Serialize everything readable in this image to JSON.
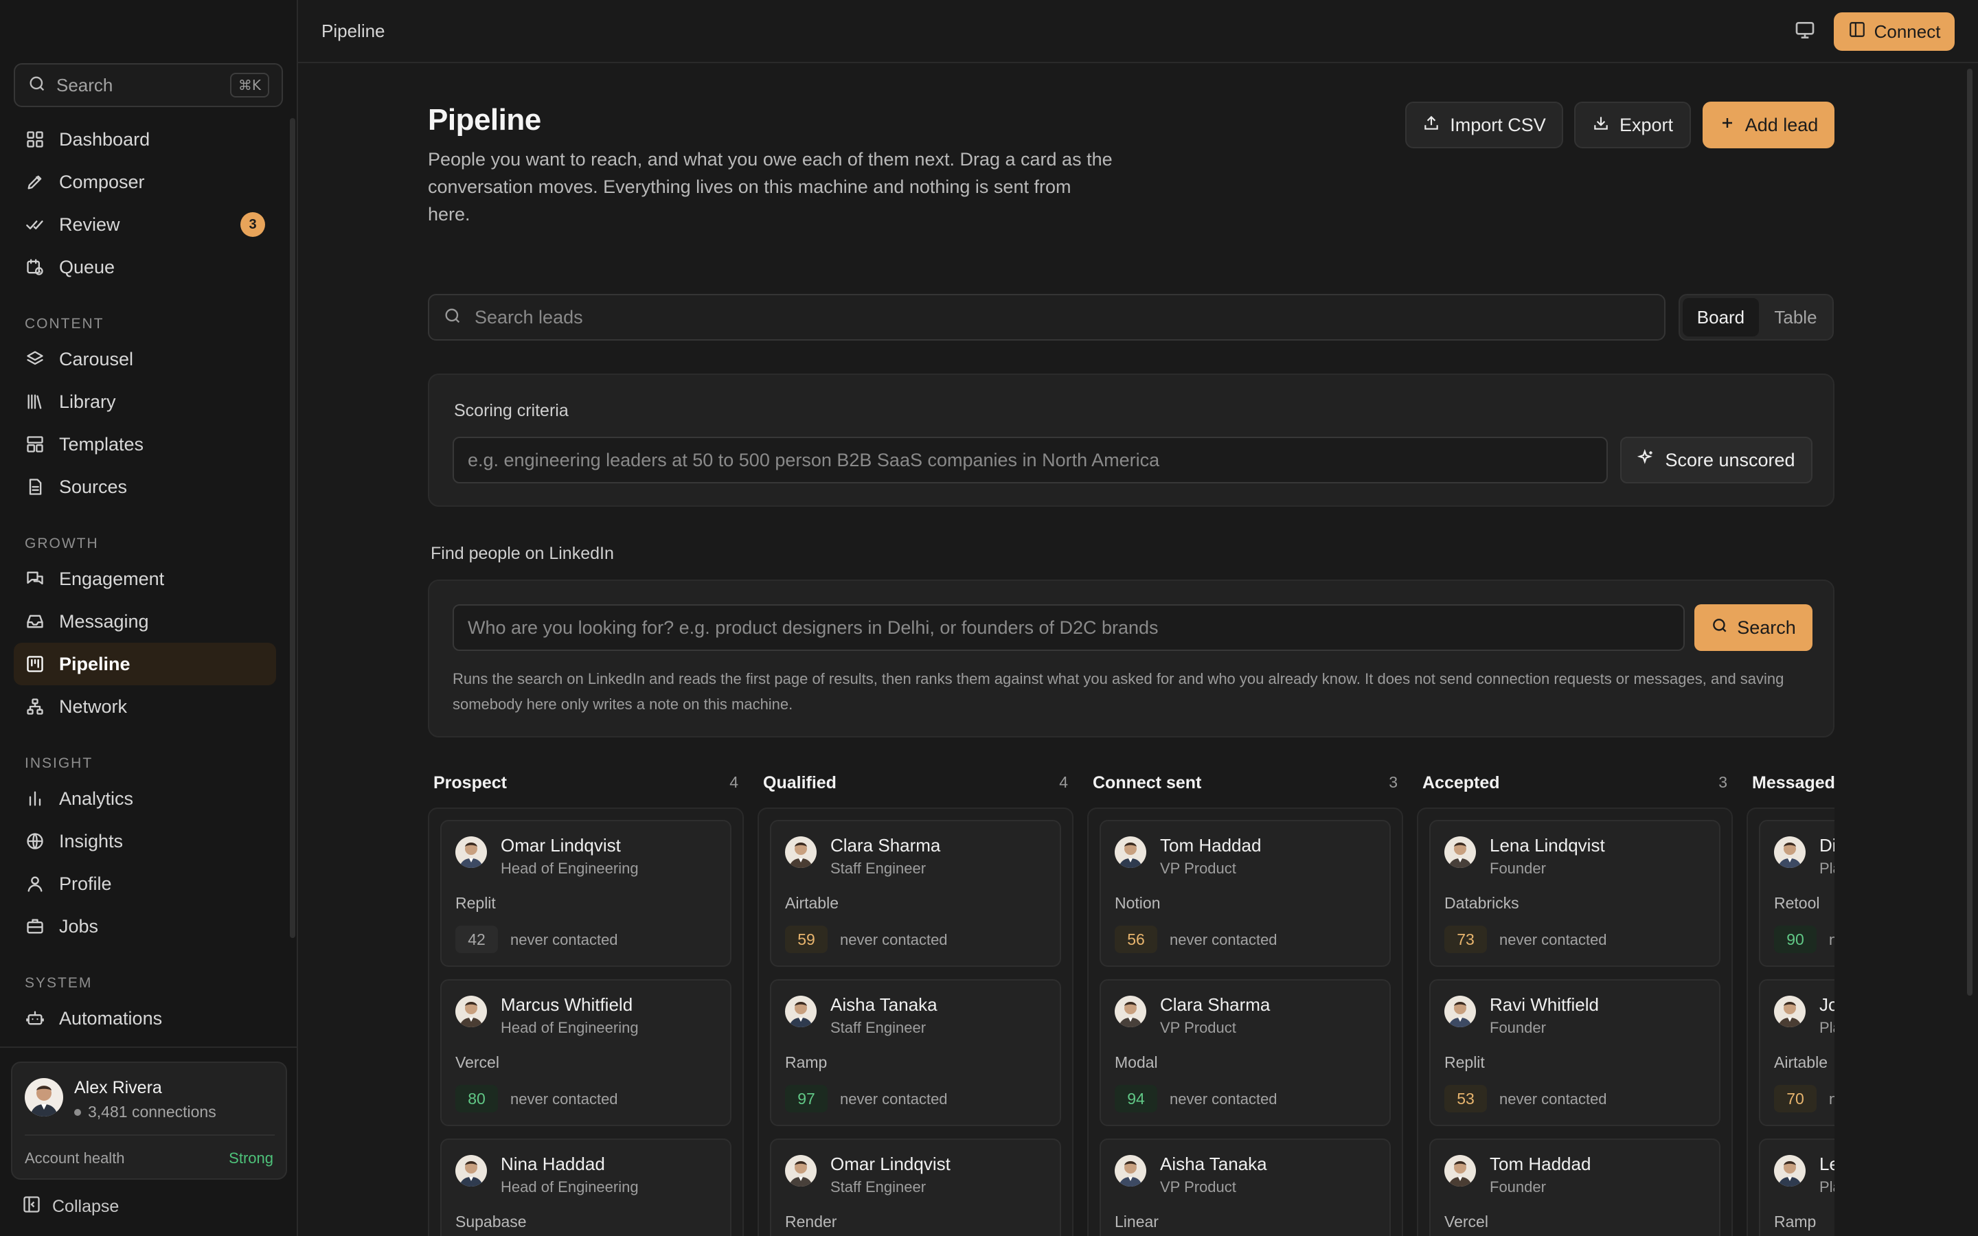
{
  "sidebar": {
    "search": {
      "label": "Search",
      "shortcut": "⌘K"
    },
    "nav_top": [
      {
        "label": "Dashboard",
        "icon": "grid-icon"
      },
      {
        "label": "Composer",
        "icon": "pen-icon"
      },
      {
        "label": "Review",
        "icon": "double-check-icon",
        "badge": "3"
      },
      {
        "label": "Queue",
        "icon": "calendar-clock-icon"
      }
    ],
    "sections": [
      {
        "title": "CONTENT",
        "items": [
          {
            "label": "Carousel",
            "icon": "layers-icon"
          },
          {
            "label": "Library",
            "icon": "library-icon"
          },
          {
            "label": "Templates",
            "icon": "layout-icon"
          },
          {
            "label": "Sources",
            "icon": "file-icon"
          }
        ]
      },
      {
        "title": "GROWTH",
        "items": [
          {
            "label": "Engagement",
            "icon": "messages-icon"
          },
          {
            "label": "Messaging",
            "icon": "inbox-icon"
          },
          {
            "label": "Pipeline",
            "icon": "kanban-icon",
            "active": true
          },
          {
            "label": "Network",
            "icon": "network-icon"
          }
        ]
      },
      {
        "title": "INSIGHT",
        "items": [
          {
            "label": "Analytics",
            "icon": "bar-chart-icon"
          },
          {
            "label": "Insights",
            "icon": "globe-icon"
          },
          {
            "label": "Profile",
            "icon": "user-icon"
          },
          {
            "label": "Jobs",
            "icon": "briefcase-icon"
          }
        ]
      },
      {
        "title": "SYSTEM",
        "items": [
          {
            "label": "Automations",
            "icon": "bot-icon"
          }
        ]
      }
    ],
    "profile": {
      "name": "Alex Rivera",
      "connections": "3,481 connections",
      "health_label": "Account health",
      "health_value": "Strong"
    },
    "collapse_label": "Collapse"
  },
  "topbar": {
    "breadcrumb": "Pipeline",
    "connect_label": "Connect"
  },
  "header": {
    "title": "Pipeline",
    "subtitle": "People you want to reach, and what you owe each of them next. Drag a card as the conversation moves. Everything lives on this machine and nothing is sent from here.",
    "import_label": "Import CSV",
    "export_label": "Export",
    "add_label": "Add lead"
  },
  "lead_search": {
    "placeholder": "Search leads"
  },
  "view_toggle": {
    "board": "Board",
    "table": "Table",
    "selected": "Board"
  },
  "scoring": {
    "title": "Scoring criteria",
    "placeholder": "e.g. engineering leaders at 50 to 500 person B2B SaaS companies in North America",
    "button": "Score unscored"
  },
  "linkedin": {
    "title": "Find people on LinkedIn",
    "placeholder": "Who are you looking for? e.g. product designers in Delhi, or founders of D2C brands",
    "button": "Search",
    "note": "Runs the search on LinkedIn and reads the first page of results, then ranks them against what you asked for and who you already know. It does not send connection requests or messages, and saving somebody here only writes a note on this machine."
  },
  "board": {
    "columns": [
      {
        "name": "Prospect",
        "count": "4",
        "cards": [
          {
            "name": "Omar Lindqvist",
            "role": "Head of Engineering",
            "company": "Replit",
            "score": "42",
            "tier": "low",
            "status": "never contacted"
          },
          {
            "name": "Marcus Whitfield",
            "role": "Head of Engineering",
            "company": "Vercel",
            "score": "80",
            "tier": "high",
            "status": "never contacted"
          },
          {
            "name": "Nina Haddad",
            "role": "Head of Engineering",
            "company": "Supabase",
            "score": "",
            "tier": "low",
            "status": ""
          }
        ]
      },
      {
        "name": "Qualified",
        "count": "4",
        "cards": [
          {
            "name": "Clara Sharma",
            "role": "Staff Engineer",
            "company": "Airtable",
            "score": "59",
            "tier": "mid",
            "status": "never contacted"
          },
          {
            "name": "Aisha Tanaka",
            "role": "Staff Engineer",
            "company": "Ramp",
            "score": "97",
            "tier": "high",
            "status": "never contacted"
          },
          {
            "name": "Omar Lindqvist",
            "role": "Staff Engineer",
            "company": "Render",
            "score": "",
            "tier": "low",
            "status": ""
          }
        ]
      },
      {
        "name": "Connect sent",
        "count": "3",
        "cards": [
          {
            "name": "Tom Haddad",
            "role": "VP Product",
            "company": "Notion",
            "score": "56",
            "tier": "mid",
            "status": "never contacted"
          },
          {
            "name": "Clara Sharma",
            "role": "VP Product",
            "company": "Modal",
            "score": "94",
            "tier": "high",
            "status": "never contacted"
          },
          {
            "name": "Aisha Tanaka",
            "role": "VP Product",
            "company": "Linear",
            "score": "",
            "tier": "low",
            "status": ""
          }
        ]
      },
      {
        "name": "Accepted",
        "count": "3",
        "cards": [
          {
            "name": "Lena Lindqvist",
            "role": "Founder",
            "company": "Databricks",
            "score": "73",
            "tier": "mid",
            "status": "never contacted"
          },
          {
            "name": "Ravi Whitfield",
            "role": "Founder",
            "company": "Replit",
            "score": "53",
            "tier": "mid",
            "status": "never contacted"
          },
          {
            "name": "Tom Haddad",
            "role": "Founder",
            "company": "Vercel",
            "score": "",
            "tier": "low",
            "status": ""
          }
        ]
      },
      {
        "name": "Messaged",
        "count": "",
        "cards": [
          {
            "name": "Di",
            "role": "Pla",
            "company": "Retool",
            "score": "90",
            "tier": "high",
            "status": "n"
          },
          {
            "name": "Jo",
            "role": "Pla",
            "company": "Airtable",
            "score": "70",
            "tier": "mid",
            "status": "n"
          },
          {
            "name": "Le",
            "role": "Pla",
            "company": "Ramp",
            "score": "",
            "tier": "low",
            "status": ""
          }
        ]
      }
    ]
  },
  "colors": {
    "accent": "#e8a45a",
    "positive": "#4ec27a",
    "background": "#1a1a1a"
  }
}
